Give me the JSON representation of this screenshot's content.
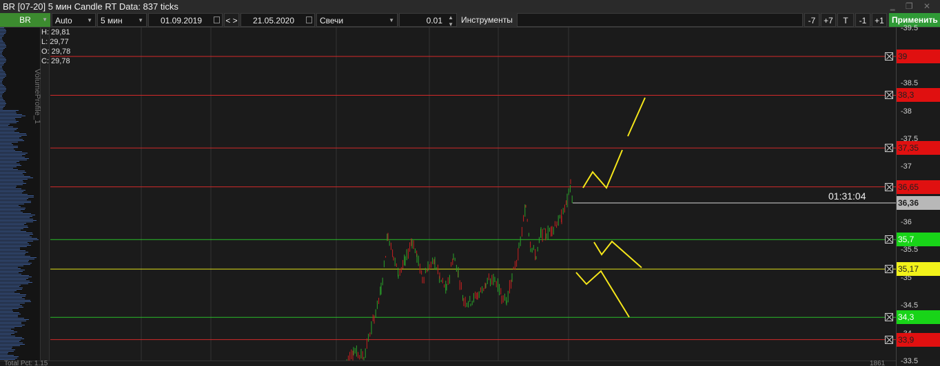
{
  "window": {
    "title": "BR [07-20] 5 мин Candle RT Data: 837 ticks"
  },
  "toolbar": {
    "symbol": "BR",
    "scale_mode": "Auto",
    "timeframe": "5 мин",
    "date_from": "01.09.2019",
    "nav_label": "< >",
    "date_to": "21.05.2020",
    "chart_type": "Свечи",
    "step_value": "0.01",
    "instruments_label": "Инструменты",
    "btn_minus7": "-7",
    "btn_plus7": "+7",
    "btn_t": "T",
    "btn_minus1": "-1",
    "btn_plus1": "+1",
    "apply_label": "Применить"
  },
  "ohlc": {
    "high": "H: 29,81",
    "low": "L: 29,77",
    "open": "O: 29,78",
    "close": "C: 29,78"
  },
  "side_panel": {
    "label": "VolumeProfile_1"
  },
  "timer": "01:31:04",
  "price_axis": {
    "ticks": [
      "-39.5",
      "-38.5",
      "-38",
      "-37.5",
      "-37",
      "-36",
      "-35.5",
      "-35",
      "-34.5",
      "-34",
      "-33.5"
    ]
  },
  "levels": [
    {
      "label": "39",
      "price": 39.0,
      "line_color": "#d42a2a",
      "badge_color": "#e01010",
      "text_color": "#202020"
    },
    {
      "label": "38,3",
      "price": 38.3,
      "line_color": "#d42a2a",
      "badge_color": "#e01010",
      "text_color": "#202020"
    },
    {
      "label": "37,35",
      "price": 37.35,
      "line_color": "#d42a2a",
      "badge_color": "#e01010",
      "text_color": "#202020"
    },
    {
      "label": "36,65",
      "price": 36.65,
      "line_color": "#d42a2a",
      "badge_color": "#e01010",
      "text_color": "#202020"
    },
    {
      "label": "35,7",
      "price": 35.7,
      "line_color": "#2bc02b",
      "badge_color": "#18d418",
      "text_color": "#ffffff"
    },
    {
      "label": "35,17",
      "price": 35.17,
      "line_color": "#e6e61a",
      "badge_color": "#f2f21a",
      "text_color": "#202020"
    },
    {
      "label": "34,3",
      "price": 34.3,
      "line_color": "#2bc02b",
      "badge_color": "#18d418",
      "text_color": "#ffffff"
    },
    {
      "label": "33,9",
      "price": 33.9,
      "line_color": "#d42a2a",
      "badge_color": "#e01010",
      "text_color": "#202020"
    }
  ],
  "current_price": {
    "label": "36,36",
    "price": 36.36,
    "badge_color": "#b8b8b8",
    "text_color": "#202020"
  },
  "bottom": {
    "left_text": "Total Pct: 1.15",
    "right_text": "1861"
  },
  "colors": {
    "background": "#1b1b1b",
    "candle_up": "#2aa52a",
    "candle_down": "#c82020",
    "drawing": "#f5e61a",
    "profile": "#3e5f9c"
  }
}
